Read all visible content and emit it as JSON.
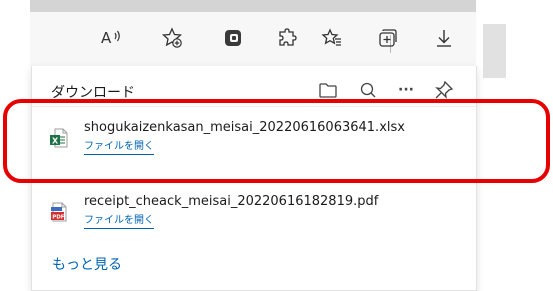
{
  "toolbar": {
    "icons": [
      "read-aloud-icon",
      "add-favorite-icon",
      "extension-icon",
      "puzzle-icon",
      "favorites-icon",
      "collections-icon",
      "download-icon"
    ],
    "read_aloud_glyph": "A̵ʾ"
  },
  "downloads": {
    "title": "ダウンロード",
    "header_icons": [
      "folder-icon",
      "search-icon",
      "more-icon",
      "pin-icon"
    ],
    "more_glyph": "···",
    "items": [
      {
        "file_name": "shogukaizenkasan_meisai_20220616063641.xlsx",
        "open_label": "ファイルを開く",
        "file_type": "xlsx",
        "icon": "excel-file-icon"
      },
      {
        "file_name": "receipt_cheack_meisai_20220616182819.pdf",
        "open_label": "ファイルを開く",
        "file_type": "pdf",
        "icon": "pdf-file-icon"
      }
    ],
    "see_more_label": "もっと見る"
  },
  "colors": {
    "accent": "#0063b1",
    "highlight": "#e60000",
    "excel": "#1e7145",
    "pdf": "#d32f2f"
  }
}
